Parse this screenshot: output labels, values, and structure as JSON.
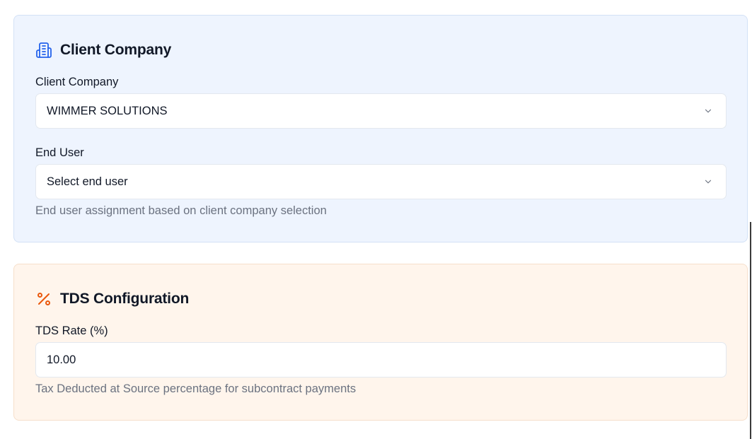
{
  "client_section": {
    "title": "Client Company",
    "icon": "building-icon",
    "accent_color": "#2563eb",
    "client_company": {
      "label": "Client Company",
      "selected_value": "WIMMER SOLUTIONS"
    },
    "end_user": {
      "label": "End User",
      "selected_value": "Select end user",
      "helper": "End user assignment based on client company selection"
    }
  },
  "tds_section": {
    "title": "TDS Configuration",
    "icon": "percent-icon",
    "accent_color": "#ea580c",
    "tds_rate": {
      "label": "TDS Rate (%)",
      "value": "10.00",
      "helper": "Tax Deducted at Source percentage for subcontract payments"
    }
  }
}
